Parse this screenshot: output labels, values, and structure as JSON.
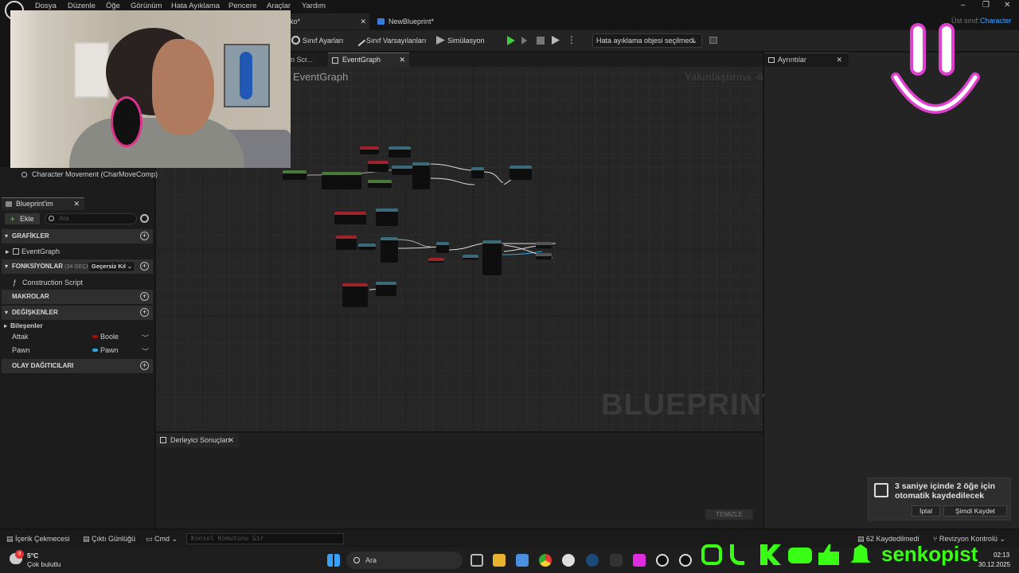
{
  "menubar": {
    "items": [
      "Dosya",
      "Düzenle",
      "Öğe",
      "Görünüm",
      "Hata Ayıklama",
      "Pencere",
      "Araçlar",
      "Yardım"
    ],
    "parent_class_label": "Üst sınıf:",
    "parent_class_value": "Character"
  },
  "tabs": {
    "partial_tab": "ko*",
    "active_doc": "NewBlueprint*"
  },
  "toolbar": {
    "class_settings": "Sınıf Ayarları",
    "class_defaults": "Sınıf Varsayılanları",
    "simulation": "Simülasyon",
    "debug_object": "Hata ayıklama objesi seçilmedi"
  },
  "graph": {
    "tab_partial": "on Scr...",
    "tab_active": "EventGraph",
    "title": "EventGraph",
    "zoom": "Yakınlaştırma -6",
    "watermark": "BLUEPRINT"
  },
  "details": {
    "tab": "Ayrıntılar"
  },
  "components": {
    "character_movement": "Character Movement (CharMoveComp)"
  },
  "my_blueprint": {
    "tab": "Blueprint'im",
    "add_button": "Ekle",
    "search_placeholder": "Ara",
    "sections": {
      "graphs": "GRAFİKLER",
      "functions": "FONKSİYONLAR",
      "functions_count": "(34 GEÇERSİ",
      "override_label": "Geçersiz Kıl",
      "macros": "MAKROLAR",
      "variables": "DEĞİŞKENLER",
      "dispatchers": "OLAY DAĞITICILARI"
    },
    "event_graph": "EventGraph",
    "construction_script": "Construction Script",
    "components_group": "Bileşenler",
    "variables": [
      {
        "name": "Attak",
        "type": "Boole",
        "color": "#a01010"
      },
      {
        "name": "Pawn",
        "type": "Pawn",
        "color": "#2ea8e0"
      }
    ]
  },
  "compiler": {
    "tab": "Derleyici Sonuçları",
    "clear_button": "TEMİZLE"
  },
  "autosave": {
    "message": "3 saniye içinde 2 öğe için otomatik kaydedilecek",
    "cancel": "İptal",
    "save_now": "Şimdi Kaydet"
  },
  "statusbar": {
    "content_drawer": "İçerik Çekmecesi",
    "output_log": "Çıktı Günlüğü",
    "cmd": "Cmd",
    "console_placeholder": "Konsol Komutunu Gir",
    "unsaved": "62 Kaydedilmedi",
    "source_control": "Revizyon Kontrolü"
  },
  "taskbar": {
    "weather_temp": "5°C",
    "weather_desc": "Çok bulutlu",
    "weather_badge": "9",
    "search": "Ara",
    "time": "02:13",
    "date": "30.12.2025"
  },
  "overlay": {
    "channel_name": "senkopist",
    "brand_color": "#39ff14"
  }
}
